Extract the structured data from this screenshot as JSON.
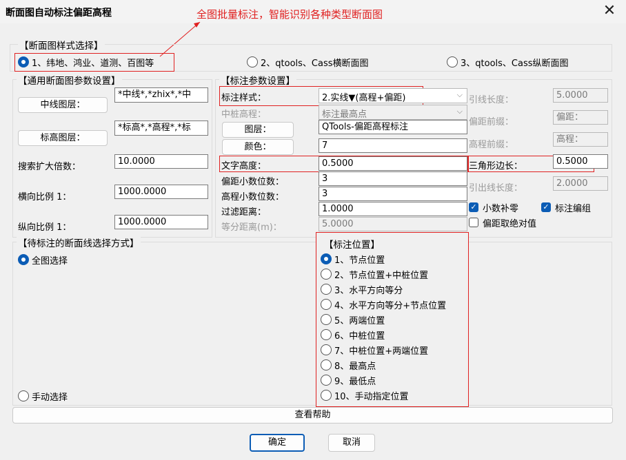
{
  "window": {
    "title": "断面图自动标注偏距高程",
    "close_glyph": "✕"
  },
  "annotation": "全图批量标注，智能识别各种类型断面图",
  "style_group": {
    "title": "【断面图样式选择】",
    "options": [
      "1、纬地、鸿业、道测、百图等",
      "2、qtools、Cass横断面图",
      "3、qtools、Cass纵断面图"
    ],
    "selected_index": 0
  },
  "general": {
    "title": "【通用断面图参数设置】",
    "center_layer_button": "中线图层：",
    "center_layer_value": "*中线*,*zhix*,*中",
    "elev_layer_button": "标高图层：",
    "elev_layer_value": "*标高*,*高程*,*标",
    "search_label": "搜索扩大倍数：",
    "search_value": "10.0000",
    "hscale_label": "横向比例 1：",
    "hscale_value": "1000.0000",
    "vscale_label": "纵向比例 1：",
    "vscale_value": "1000.0000"
  },
  "params": {
    "title": "【标注参数设置】",
    "style_label": "标注样式：",
    "style_value": "2.实线▼(高程+偏距)",
    "center_elev_label": "中桩高程：",
    "center_elev_value": "标注最高点",
    "layer_button": "图层：",
    "layer_value": "QTools-偏距高程标注",
    "color_button": "颜色：",
    "color_value": "7",
    "text_height_label": "文字高度：",
    "text_height_value": "0.5000",
    "offset_dec_label": "偏距小数位数：",
    "offset_dec_value": "3",
    "elev_dec_label": "高程小数位数：",
    "elev_dec_value": "3",
    "filter_label": "过滤距离：",
    "filter_value": "1.0000",
    "equal_label": "等分距离(m)：",
    "equal_value": "5.0000",
    "leader_len_label": "引线长度：",
    "leader_len_value": "5.0000",
    "offset_prefix_label": "偏距前缀：",
    "offset_prefix_value": "偏距：",
    "elev_prefix_label": "高程前缀：",
    "elev_prefix_value": "高程：",
    "triangle_label": "三角形边长：",
    "triangle_value": "0.5000",
    "out_len_label": "引出线长度：",
    "out_len_value": "2.0000",
    "chk_decimal": "小数补零",
    "chk_group": "标注编组",
    "chk_abs": "偏距取绝对值"
  },
  "selection": {
    "title": "【待标注的断面线选择方式】",
    "all": "全图选择",
    "manual": "手动选择"
  },
  "positions": {
    "title": "【标注位置】",
    "items": [
      "1、节点位置",
      "2、节点位置+中桩位置",
      "3、水平方向等分",
      "4、水平方向等分+节点位置",
      "5、两端位置",
      "6、中桩位置",
      "7、中桩位置+两端位置",
      "8、最高点",
      "9、最低点",
      "10、手动指定位置"
    ],
    "selected_index": 0
  },
  "help_button": "查看帮助",
  "ok_button": "确定",
  "cancel_button": "取消",
  "colors": {
    "accent": "#0b5cb5",
    "annotation_red": "#e02020"
  }
}
